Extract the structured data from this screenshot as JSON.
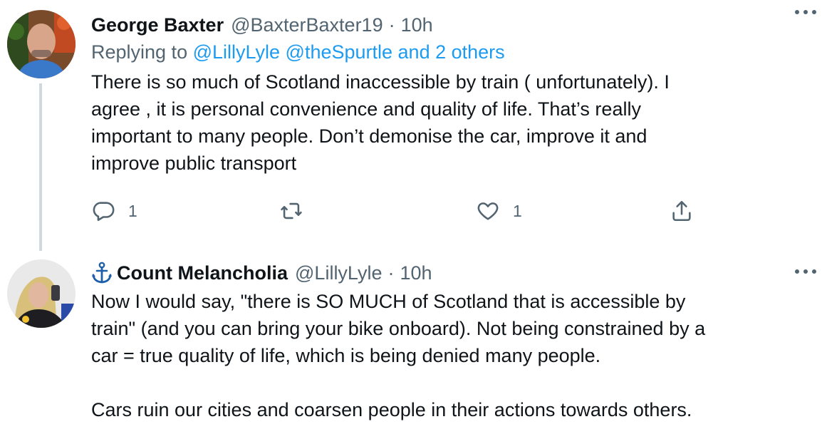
{
  "tweets": [
    {
      "name": "George Baxter",
      "handle": "@BaxterBaxter19",
      "separator": "·",
      "time": "10h",
      "replying_prefix": "Replying to ",
      "replying_targets": "@LillyLyle @theSpurtle and 2 others",
      "text": "There is so much of Scotland inaccessible by train ( unfortunately). I\nagree , it is personal convenience and quality of life. That’s really\nimportant to many people. Don’t demonise the car, improve it and\nimprove public transport",
      "actions": {
        "reply_count": "1",
        "retweet_count": "",
        "like_count": "1"
      }
    },
    {
      "name": "Count Melancholia",
      "name_icon": "anchor-icon",
      "handle": "@LillyLyle",
      "separator": "·",
      "time": "10h",
      "text": "Now I would say, \"there is SO MUCH of Scotland that is accessible by\ntrain\" (and you can bring your bike onboard). Not being constrained by a\ncar = true quality of life, which is being denied many people.\n\nCars ruin our cities and coarsen people in their actions towards others."
    }
  ],
  "colors": {
    "primary_text": "#0f1419",
    "secondary_text": "#536471",
    "link": "#1d9bf0",
    "thread_line": "#cfd9de",
    "anchor": "#1d5fa8"
  }
}
